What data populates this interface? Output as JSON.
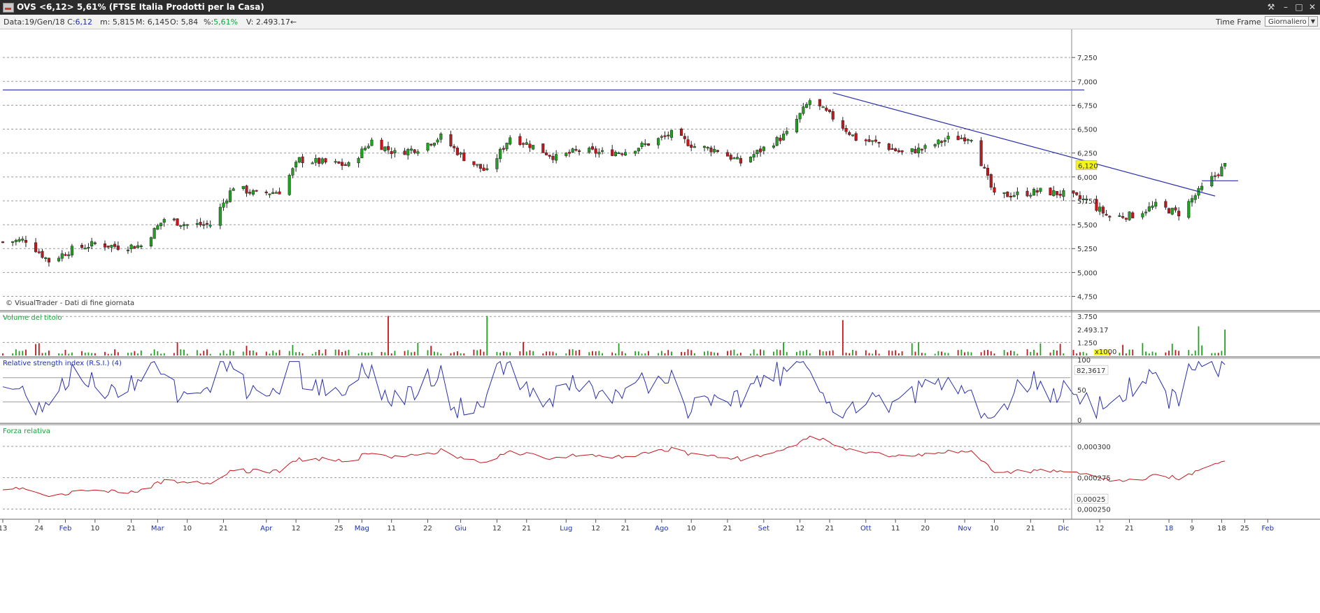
{
  "window": {
    "title": "OVS <6,12> 5,61%  (FTSE Italia Prodotti per la Casa)"
  },
  "infobar": {
    "date_label": "Data:",
    "date_value": "19/Gen/18",
    "close_label": "C:",
    "close_value": "6,12",
    "low_label": "m:",
    "low_value": "5,815",
    "high_label": "M:",
    "high_value": "6,145",
    "open_label": "O:",
    "open_value": "5,84",
    "pct_label": "%:",
    "pct_value": "5,61%",
    "vol_label": "V:",
    "vol_value": "2.493.17←",
    "timeframe_label": "Time Frame",
    "timeframe_value": "Giornaliero"
  },
  "chart_data": [
    {
      "type": "candlestick",
      "panel": "price",
      "credit": "© VisualTrader - Dati di fine giornata",
      "ylim": [
        4.6,
        7.5
      ],
      "yticks": [
        "7,250",
        "7,000",
        "6,750",
        "6,500",
        "6,250",
        "6,000",
        "5,750",
        "5,500",
        "5,250",
        "5,000",
        "4,750"
      ],
      "ytick_values": [
        7.25,
        7.0,
        6.75,
        6.5,
        6.25,
        6.0,
        5.75,
        5.5,
        5.25,
        5.0,
        4.75
      ],
      "last_value": "6,120",
      "horizontal_line": 6.91,
      "trendline": [
        {
          "date": "2017-09-22",
          "value": 6.88
        },
        {
          "date": "2018-01-16",
          "value": 5.8
        }
      ],
      "box_line": {
        "from": "2018-01-12",
        "to": "2018-01-23",
        "value": 5.96
      },
      "series": [
        {
          "date": "2017-01-13",
          "value": 5.32
        },
        {
          "date": "2017-01-20",
          "value": 5.34
        },
        {
          "date": "2017-01-27",
          "value": 5.12
        },
        {
          "date": "2017-02-03",
          "value": 5.24
        },
        {
          "date": "2017-02-10",
          "value": 5.3
        },
        {
          "date": "2017-02-17",
          "value": 5.27
        },
        {
          "date": "2017-02-24",
          "value": 5.28
        },
        {
          "date": "2017-03-03",
          "value": 5.56
        },
        {
          "date": "2017-03-10",
          "value": 5.5
        },
        {
          "date": "2017-03-17",
          "value": 5.5
        },
        {
          "date": "2017-03-24",
          "value": 5.9
        },
        {
          "date": "2017-03-31",
          "value": 5.82
        },
        {
          "date": "2017-04-07",
          "value": 5.85
        },
        {
          "date": "2017-04-13",
          "value": 6.18
        },
        {
          "date": "2017-04-21",
          "value": 6.15
        },
        {
          "date": "2017-04-28",
          "value": 6.12
        },
        {
          "date": "2017-05-05",
          "value": 6.38
        },
        {
          "date": "2017-05-12",
          "value": 6.25
        },
        {
          "date": "2017-05-19",
          "value": 6.3
        },
        {
          "date": "2017-05-26",
          "value": 6.42
        },
        {
          "date": "2017-06-02",
          "value": 6.2
        },
        {
          "date": "2017-06-09",
          "value": 6.05
        },
        {
          "date": "2017-06-16",
          "value": 6.42
        },
        {
          "date": "2017-06-23",
          "value": 6.32
        },
        {
          "date": "2017-06-30",
          "value": 6.2
        },
        {
          "date": "2017-07-07",
          "value": 6.28
        },
        {
          "date": "2017-07-14",
          "value": 6.25
        },
        {
          "date": "2017-07-21",
          "value": 6.27
        },
        {
          "date": "2017-07-28",
          "value": 6.35
        },
        {
          "date": "2017-08-04",
          "value": 6.45
        },
        {
          "date": "2017-08-11",
          "value": 6.32
        },
        {
          "date": "2017-08-18",
          "value": 6.28
        },
        {
          "date": "2017-08-25",
          "value": 6.15
        },
        {
          "date": "2017-09-01",
          "value": 6.3
        },
        {
          "date": "2017-09-08",
          "value": 6.45
        },
        {
          "date": "2017-09-15",
          "value": 6.8
        },
        {
          "date": "2017-09-22",
          "value": 6.62
        },
        {
          "date": "2017-09-29",
          "value": 6.4
        },
        {
          "date": "2017-10-06",
          "value": 6.35
        },
        {
          "date": "2017-10-13",
          "value": 6.25
        },
        {
          "date": "2017-10-20",
          "value": 6.3
        },
        {
          "date": "2017-10-27",
          "value": 6.4
        },
        {
          "date": "2017-11-03",
          "value": 6.42
        },
        {
          "date": "2017-11-10",
          "value": 5.8
        },
        {
          "date": "2017-11-17",
          "value": 5.82
        },
        {
          "date": "2017-11-24",
          "value": 5.85
        },
        {
          "date": "2017-12-01",
          "value": 5.82
        },
        {
          "date": "2017-12-08",
          "value": 5.75
        },
        {
          "date": "2017-12-15",
          "value": 5.58
        },
        {
          "date": "2017-12-22",
          "value": 5.6
        },
        {
          "date": "2017-12-29",
          "value": 5.7
        },
        {
          "date": "2018-01-05",
          "value": 5.62
        },
        {
          "date": "2018-01-12",
          "value": 5.88
        },
        {
          "date": "2018-01-19",
          "value": 6.12
        }
      ]
    },
    {
      "type": "bar",
      "panel": "volume",
      "title": "Volume del titolo",
      "yticks": [
        "3.750",
        "1.250"
      ],
      "ytick_values": [
        3750,
        1250
      ],
      "ylim": [
        0,
        4100
      ],
      "last_value": "2.493.17",
      "unit_label": "x1000",
      "spikes": [
        {
          "date": "2017-05-10",
          "value": 3800
        },
        {
          "date": "2017-06-09",
          "value": 3800
        },
        {
          "date": "2017-09-25",
          "value": 3400
        },
        {
          "date": "2018-01-11",
          "value": 2800
        },
        {
          "date": "2018-01-19",
          "value": 2493
        }
      ]
    },
    {
      "type": "line",
      "panel": "rsi",
      "title": "Relative strength index (R.S.I.) (4)",
      "yticks": [
        "100",
        "50",
        "0"
      ],
      "ytick_values": [
        100,
        50,
        0
      ],
      "ylim": [
        0,
        100
      ],
      "last_value": "82,3617"
    },
    {
      "type": "line",
      "panel": "forza",
      "title": "Forza relativa",
      "yticks": [
        "0,000300",
        "0,000275",
        "0,000250"
      ],
      "ytick_values": [
        0.0003,
        0.000275,
        0.00025
      ],
      "ylim": [
        0.000243,
        0.000315
      ],
      "last_value": "0,00025"
    }
  ],
  "time_axis": {
    "start": "2017-01-13",
    "end": "2018-02-09",
    "labels": [
      {
        "date": "2017-01-13",
        "text": "13",
        "month": false
      },
      {
        "date": "2017-01-24",
        "text": "24",
        "month": false
      },
      {
        "date": "2017-02-01",
        "text": "Feb",
        "month": true
      },
      {
        "date": "2017-02-10",
        "text": "10",
        "month": false
      },
      {
        "date": "2017-02-21",
        "text": "21",
        "month": false
      },
      {
        "date": "2017-03-01",
        "text": "Mar",
        "month": true
      },
      {
        "date": "2017-03-10",
        "text": "10",
        "month": false
      },
      {
        "date": "2017-03-21",
        "text": "21",
        "month": false
      },
      {
        "date": "2017-04-03",
        "text": "Apr",
        "month": true
      },
      {
        "date": "2017-04-12",
        "text": "12",
        "month": false
      },
      {
        "date": "2017-04-25",
        "text": "25",
        "month": false
      },
      {
        "date": "2017-05-02",
        "text": "Mag",
        "month": true
      },
      {
        "date": "2017-05-11",
        "text": "11",
        "month": false
      },
      {
        "date": "2017-05-22",
        "text": "22",
        "month": false
      },
      {
        "date": "2017-06-01",
        "text": "Giu",
        "month": true
      },
      {
        "date": "2017-06-12",
        "text": "12",
        "month": false
      },
      {
        "date": "2017-06-21",
        "text": "21",
        "month": false
      },
      {
        "date": "2017-07-03",
        "text": "Lug",
        "month": true
      },
      {
        "date": "2017-07-12",
        "text": "12",
        "month": false
      },
      {
        "date": "2017-07-21",
        "text": "21",
        "month": false
      },
      {
        "date": "2017-08-01",
        "text": "Ago",
        "month": true
      },
      {
        "date": "2017-08-10",
        "text": "10",
        "month": false
      },
      {
        "date": "2017-08-21",
        "text": "21",
        "month": false
      },
      {
        "date": "2017-09-01",
        "text": "Set",
        "month": true
      },
      {
        "date": "2017-09-12",
        "text": "12",
        "month": false
      },
      {
        "date": "2017-09-21",
        "text": "21",
        "month": false
      },
      {
        "date": "2017-10-02",
        "text": "Ott",
        "month": true
      },
      {
        "date": "2017-10-11",
        "text": "11",
        "month": false
      },
      {
        "date": "2017-10-20",
        "text": "20",
        "month": false
      },
      {
        "date": "2017-11-01",
        "text": "Nov",
        "month": true
      },
      {
        "date": "2017-11-10",
        "text": "10",
        "month": false
      },
      {
        "date": "2017-11-21",
        "text": "21",
        "month": false
      },
      {
        "date": "2017-12-01",
        "text": "Dic",
        "month": true
      },
      {
        "date": "2017-12-12",
        "text": "12",
        "month": false
      },
      {
        "date": "2017-12-21",
        "text": "21",
        "month": false
      },
      {
        "date": "2018-01-02",
        "text": "18",
        "month": "red"
      },
      {
        "date": "2018-01-09",
        "text": "9",
        "month": false
      },
      {
        "date": "2018-01-18",
        "text": "18",
        "month": false
      },
      {
        "date": "2018-01-25",
        "text": "25",
        "month": false
      },
      {
        "date": "2018-02-01",
        "text": "Feb",
        "month": true
      }
    ]
  },
  "colors": {
    "up": "#1fa31f",
    "down": "#c4161c",
    "trend": "#2a2fa8",
    "rsi_line": "#2a2fa8",
    "forza_line": "#c4161c",
    "titlebar": "#2b2b2b"
  }
}
